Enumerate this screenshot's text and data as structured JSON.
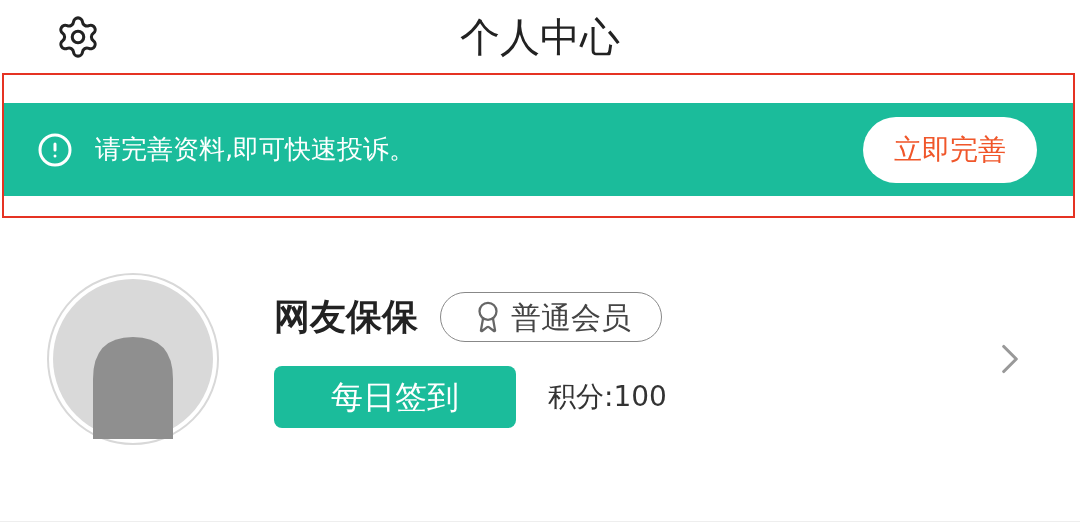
{
  "header": {
    "title": "个人中心"
  },
  "notice": {
    "message": "请完善资料,即可快速投诉。",
    "action": "立即完善"
  },
  "profile": {
    "name": "网友保保",
    "level_badge": "普通会员",
    "checkin_button": "每日签到",
    "points": "积分:100"
  }
}
